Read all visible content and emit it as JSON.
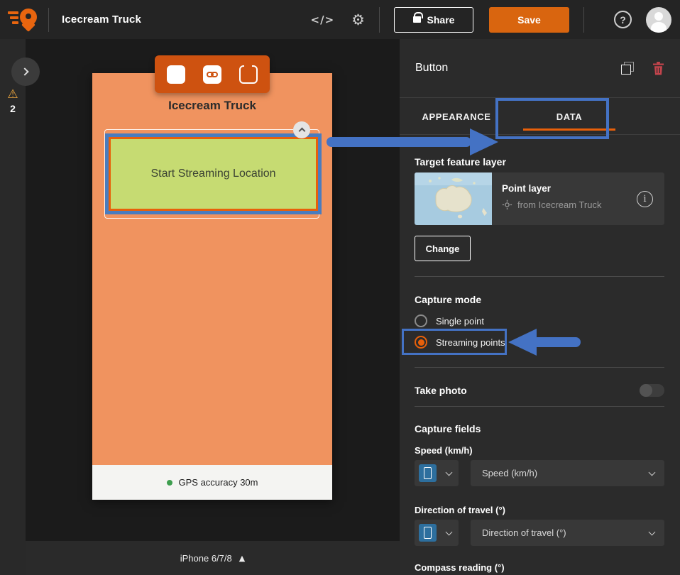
{
  "header": {
    "app_title": "Icecream Truck",
    "share_label": "Share",
    "save_label": "Save"
  },
  "sidebar": {
    "warning_count": "2"
  },
  "canvas": {
    "device_label": "iPhone 6/7/8",
    "phone": {
      "title": "Icecream Truck",
      "button_label": "Start Streaming Location",
      "gps_text": "GPS accuracy 30m"
    }
  },
  "panel": {
    "title": "Button",
    "tabs": [
      {
        "label": "APPEARANCE",
        "active": false
      },
      {
        "label": "DATA",
        "active": true
      }
    ],
    "target_layer": {
      "heading": "Target feature layer",
      "name": "Point layer",
      "source": "from Icecream Truck",
      "change_label": "Change"
    },
    "capture_mode": {
      "heading": "Capture mode",
      "options": [
        {
          "label": "Single point",
          "selected": false
        },
        {
          "label": "Streaming points",
          "selected": true
        }
      ]
    },
    "take_photo": {
      "label": "Take photo",
      "enabled": false
    },
    "capture_fields": {
      "heading": "Capture fields",
      "fields": [
        {
          "label": "Speed (km/h)",
          "value": "Speed (km/h)"
        },
        {
          "label": "Direction of travel (°)",
          "value": "Direction of travel (°)"
        },
        {
          "label": "Compass reading (°)"
        }
      ]
    }
  },
  "icons": {
    "gear": "⚙",
    "code": "</>",
    "help": "?",
    "info": "i",
    "warning": "⚠",
    "triangle_up": "▲"
  },
  "colors": {
    "accent_orange": "#E8650F",
    "save_button_orange": "#D9650F",
    "toolbar_orange": "#CE5210",
    "phone_background": "#F0935F",
    "button_fill_green": "#C6DB72",
    "selection_blue": "#4A7CBE",
    "annotation_blue": "#4472C4",
    "danger_red": "#C2444C",
    "device_icon_blue": "#2D6F9E",
    "gps_green": "#3E9E4F",
    "warning_yellow": "#E8A33D"
  }
}
